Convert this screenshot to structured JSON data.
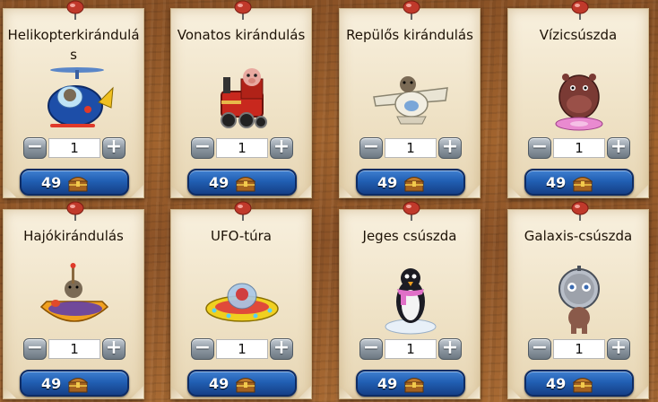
{
  "shop": {
    "items": [
      {
        "name": "Helikopterkirándulás",
        "quantity": "1",
        "price": "49",
        "icon": "helicopter-ride"
      },
      {
        "name": "Vonatos kirándulás",
        "quantity": "1",
        "price": "49",
        "icon": "train-ride"
      },
      {
        "name": "Repülős kirándulás",
        "quantity": "1",
        "price": "49",
        "icon": "airplane-ride"
      },
      {
        "name": "Vízicsúszda",
        "quantity": "1",
        "price": "49",
        "icon": "water-slide"
      },
      {
        "name": "Hajókirándulás",
        "quantity": "1",
        "price": "49",
        "icon": "boat-ride"
      },
      {
        "name": "UFO-túra",
        "quantity": "1",
        "price": "49",
        "icon": "ufo-tour"
      },
      {
        "name": "Jeges csúszda",
        "quantity": "1",
        "price": "49",
        "icon": "ice-slide"
      },
      {
        "name": "Galaxis-csúszda",
        "quantity": "1",
        "price": "49",
        "icon": "galaxy-slide"
      }
    ],
    "minus_symbol": "−",
    "plus_symbol": "+",
    "currency_icon": "treasure-chest-icon",
    "colors": {
      "price_button": "#215fb3",
      "stepper": "#8e98a2",
      "pin": "#c0392b",
      "card": "#f3e8d2"
    }
  }
}
